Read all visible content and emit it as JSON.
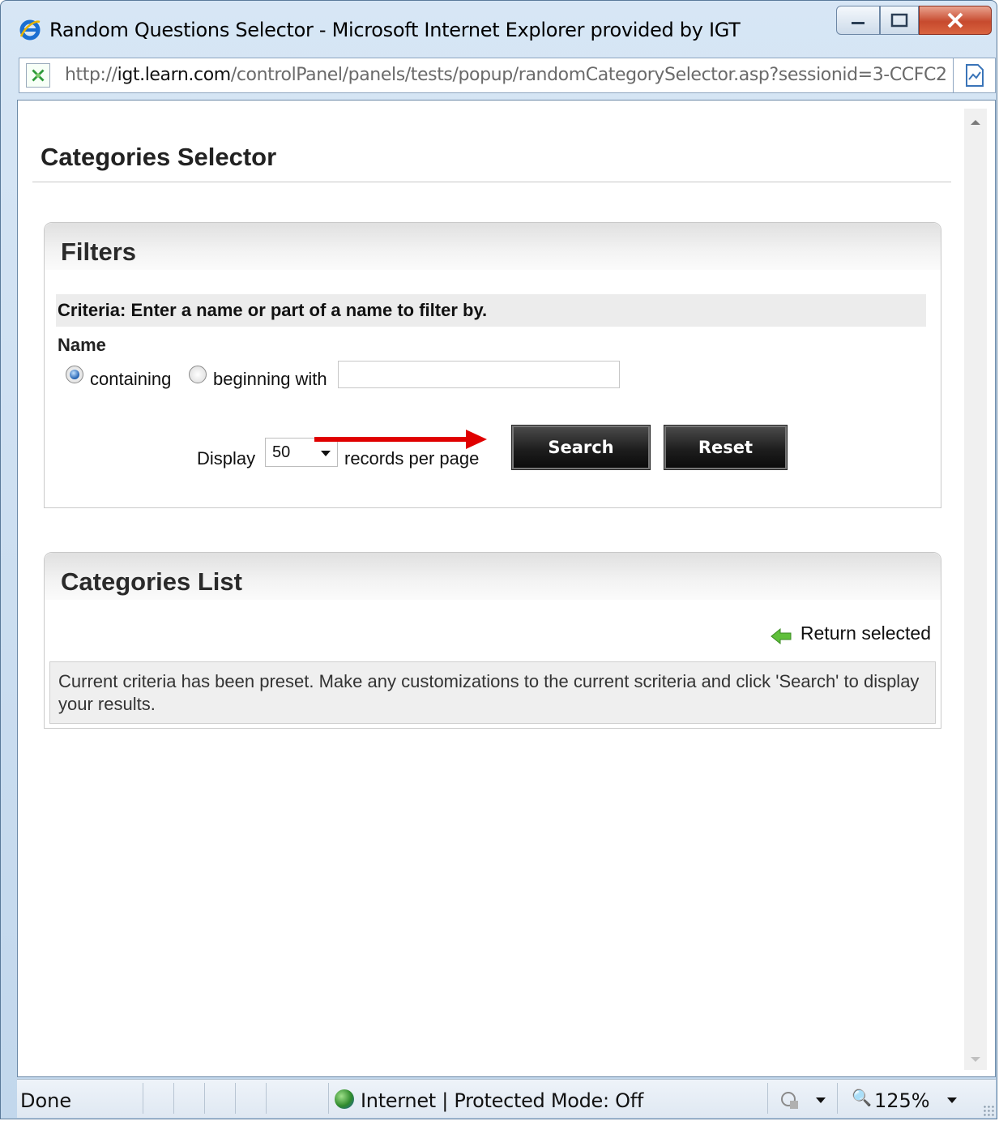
{
  "window": {
    "title": "Random Questions Selector - Microsoft Internet Explorer provided by IGT",
    "address_prefix": "http://",
    "address_domain": "igt.learn.com",
    "address_path": "/controlPanel/panels/tests/popup/randomCategorySelector.asp?sessionid=3-CCFC2"
  },
  "page": {
    "title": "Categories Selector"
  },
  "filters": {
    "heading": "Filters",
    "criteria": "Criteria: Enter a name or part of a name to filter by.",
    "name_label": "Name",
    "radio_containing": "containing",
    "radio_beginning": "beginning with",
    "selected_mode": "containing",
    "name_value": "",
    "display_label": "Display",
    "records_value": "50",
    "records_suffix": "records per page",
    "search_button": "Search",
    "reset_button": "Reset"
  },
  "categories_list": {
    "heading": "Categories List",
    "return_selected": "Return selected",
    "message": "Current criteria has been preset. Make any customizations to the current scriteria and click 'Search' to display your results."
  },
  "statusbar": {
    "status": "Done",
    "zone": "Internet | Protected Mode: Off",
    "zoom": "125%"
  },
  "colors": {
    "annotation_arrow": "#e00000",
    "button_bg": "#1e1e1e"
  }
}
